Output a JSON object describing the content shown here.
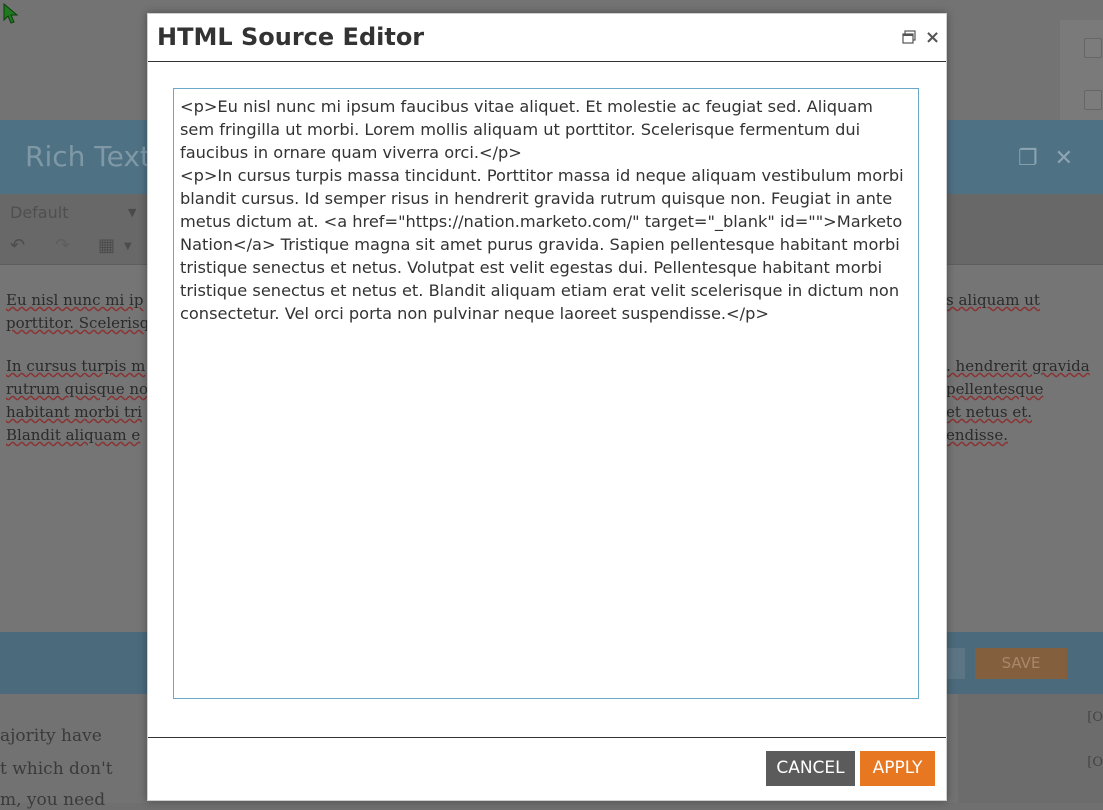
{
  "background": {
    "rte_title": "Rich Text",
    "format_select": "Default",
    "editor_lines": [
      "Eu nisl nunc mi ip",
      "porttitor. Scelerisq",
      "In cursus turpis m",
      "rutrum quisque no",
      "habitant morbi tri",
      "Blandit aliquam e"
    ],
    "editor_lines_right": [
      "s aliquam ut",
      ". hendrerit gravida",
      "pellentesque",
      " et netus et.",
      "endisse."
    ],
    "save_label": "SAVE",
    "bottom_lines": [
      "ajority have",
      "t which don't",
      "m, you need"
    ],
    "bottom_right": [
      "[O",
      "[O"
    ]
  },
  "modal": {
    "title": "HTML Source Editor",
    "source_html": "<p>Eu nisl nunc mi ipsum faucibus vitae aliquet. Et molestie ac feugiat sed. Aliquam sem fringilla ut morbi. Lorem mollis aliquam ut porttitor. Scelerisque fermentum dui faucibus in ornare quam viverra orci.</p>\n<p>In cursus turpis massa tincidunt. Porttitor massa id neque aliquam vestibulum morbi blandit cursus. Id semper risus in hendrerit gravida rutrum quisque non. Feugiat in ante metus dictum at. <a href=\"https://nation.marketo.com/\" target=\"_blank\" id=\"\">Marketo Nation</a> Tristique magna sit amet purus gravida. Sapien pellentesque habitant morbi tristique senectus et netus. Volutpat est velit egestas dui. Pellentesque habitant morbi tristique senectus et netus et. Blandit aliquam etiam erat velit scelerisque in dictum non consectetur. Vel orci porta non pulvinar neque laoreet suspendisse.</p>",
    "close_glyph": "×",
    "cancel_label": "CANCEL",
    "apply_label": "APPLY"
  },
  "colors": {
    "apply": "#e87722",
    "cancel": "#5b5b5b",
    "textarea_border": "#6aa8c9"
  }
}
